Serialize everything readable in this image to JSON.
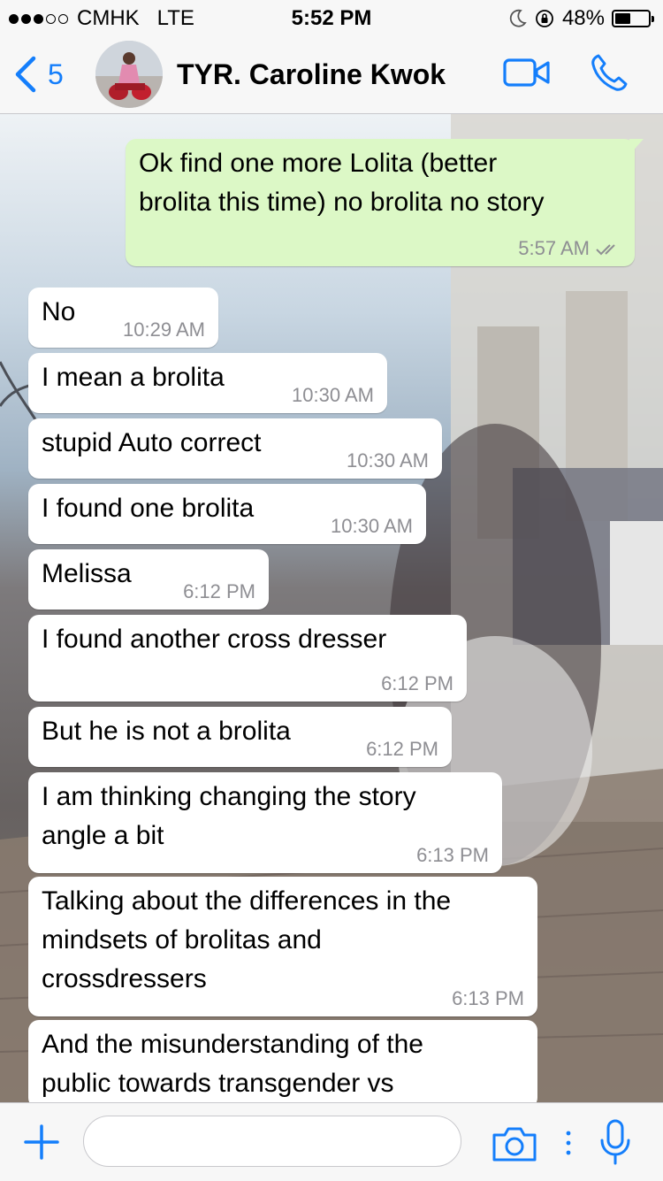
{
  "status_bar": {
    "carrier": "CMHK",
    "network": "LTE",
    "time": "5:52 PM",
    "battery": "48%",
    "battery_level": 0.48,
    "signal_bars_filled": 3,
    "signal_bars_total": 5
  },
  "nav": {
    "back_count": "5",
    "contact_name": "TYR. Caroline Kwok",
    "accent_color": "#147efb"
  },
  "colors": {
    "outgoing_bubble": "#dcf8c6",
    "incoming_bubble": "#ffffff",
    "timestamp": "#8e8e93"
  },
  "messages": [
    {
      "direction": "out",
      "text": "Ok find one more Lolita (better\nbrolita this time) no brolita no story",
      "time": "5:57 AM",
      "status": "read"
    },
    {
      "direction": "in",
      "text": "No",
      "time": "10:29 AM"
    },
    {
      "direction": "in",
      "text": "I mean a brolita",
      "time": "10:30 AM"
    },
    {
      "direction": "in",
      "text": "stupid Auto correct",
      "time": "10:30 AM"
    },
    {
      "direction": "in",
      "text": "I found one brolita",
      "time": "10:30 AM"
    },
    {
      "direction": "in",
      "text": "Melissa",
      "time": "6:12 PM"
    },
    {
      "direction": "in",
      "text": "I found another cross dresser",
      "time": "6:12 PM"
    },
    {
      "direction": "in",
      "text": "But he is not a brolita",
      "time": "6:12 PM"
    },
    {
      "direction": "in",
      "text": "I am thinking changing the story\nangle a bit",
      "time": "6:13 PM"
    },
    {
      "direction": "in",
      "text": "Talking about the differences in the\nmindsets of brolitas and\ncrossdressers",
      "time": "6:13 PM"
    },
    {
      "direction": "in",
      "text": "And the misunderstanding of the\npublic towards transgender vs",
      "time": ""
    }
  ],
  "input_bar": {
    "placeholder": ""
  }
}
